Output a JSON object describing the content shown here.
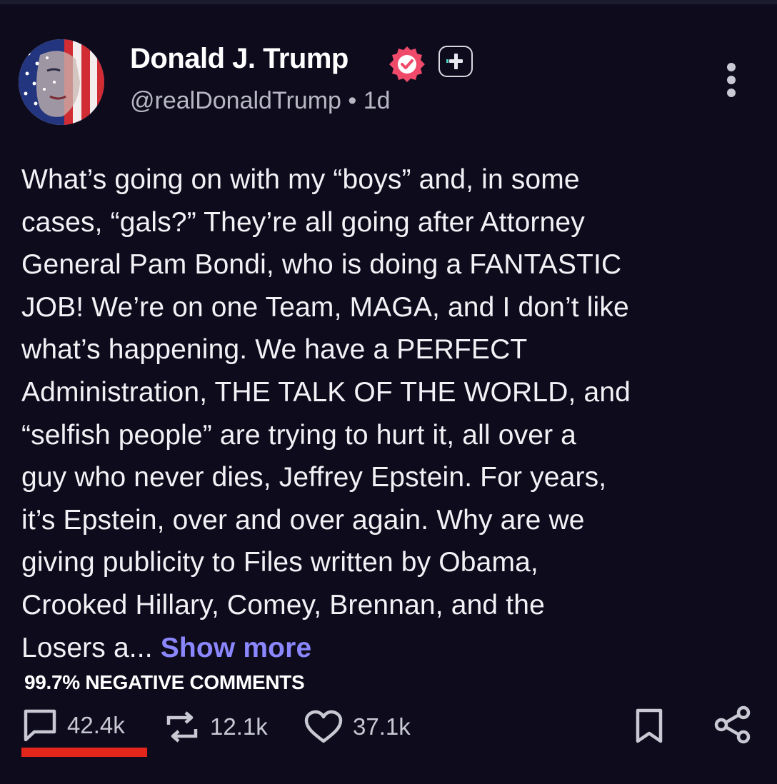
{
  "author": {
    "display_name": "Donald J. Trump",
    "handle": "@realDonaldTrump",
    "separator": "•",
    "time_ago": "1d"
  },
  "follow_button": {
    "icon": "plus-icon"
  },
  "verified_badge": {
    "icon": "verified-check-icon",
    "color": "#ef4a6a"
  },
  "post": {
    "lines": [
      "What’s going on with my “boys” and, in some",
      "cases, “gals?” They’re all going after Attorney",
      "General Pam Bondi, who is doing a FANTASTIC",
      "JOB! We’re on one Team, MAGA, and I don’t like",
      "what’s happening. We have a PERFECT",
      "Administration, THE TALK OF THE WORLD, and",
      "“selfish people” are trying to hurt it, all over a",
      "guy who never dies, Jeffrey Epstein. For years,",
      "it’s Epstein, over and over again. Why are we",
      "giving publicity to Files written by Obama,",
      "Crooked Hillary, Comey, Brennan, and the",
      "Losers a..."
    ],
    "show_more": "Show more"
  },
  "annotation": {
    "banner": "99.7% NEGATIVE COMMENTS",
    "highlight_color": "#e3261b"
  },
  "actions": {
    "comments": {
      "icon": "comment-icon",
      "count": "42.4k"
    },
    "reposts": {
      "icon": "repost-icon",
      "count": "12.1k"
    },
    "likes": {
      "icon": "heart-icon",
      "count": "37.1k"
    },
    "bookmark": {
      "icon": "bookmark-icon"
    },
    "share": {
      "icon": "share-icon"
    }
  },
  "colors": {
    "background": "#0d0b1c",
    "link": "#8b87ff",
    "muted_text": "#b8b8c4"
  }
}
